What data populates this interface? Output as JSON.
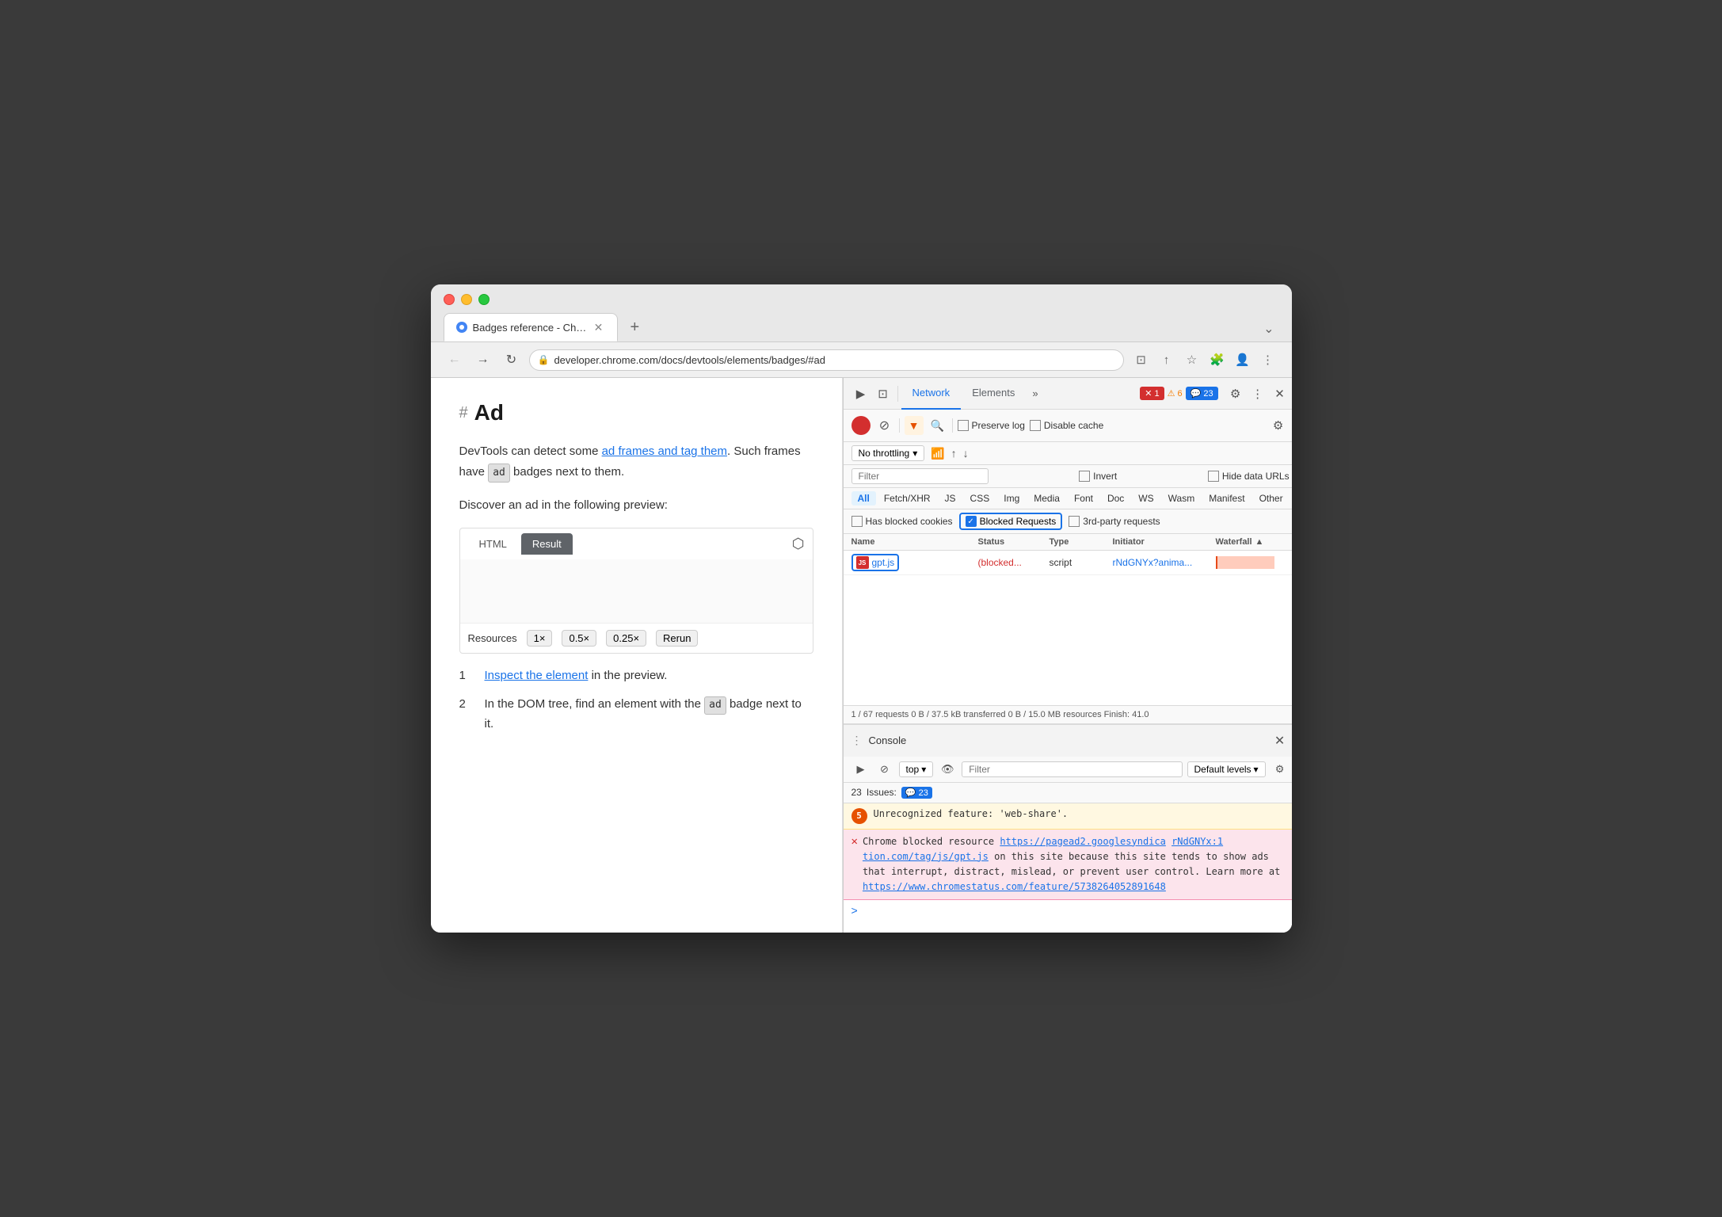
{
  "browser": {
    "tab_title": "Badges reference - Chrome De",
    "tab_favicon": "chrome",
    "address": "developer.chrome.com/docs/devtools/elements/badges/#ad",
    "expand_icon": "⌄"
  },
  "page": {
    "hash_symbol": "#",
    "title": "Ad",
    "paragraph1_before": "DevTools can detect some ",
    "paragraph1_link1": "ad frames and tag them",
    "paragraph1_mid": ". Such frames have ",
    "paragraph1_badge": "ad",
    "paragraph1_after": " badges next to them.",
    "paragraph2": "Discover an ad in the following preview:",
    "preview_tabs": [
      "HTML",
      "Result"
    ],
    "preview_tab_active": "Result",
    "preview_footer_label": "Resources",
    "preview_buttons": [
      "1×",
      "0.5×",
      "0.25×",
      "Rerun"
    ],
    "list_items": [
      {
        "num": "1",
        "text_before": "",
        "link": "Inspect the element",
        "text_after": " in the preview."
      },
      {
        "num": "2",
        "text_before": "In the DOM tree, find an element with the ",
        "badge": "ad",
        "text_after": " badge next to it."
      }
    ]
  },
  "devtools": {
    "tabs": [
      "Network",
      "Elements"
    ],
    "active_tab": "Network",
    "more_icon": "»",
    "badge_error": "1",
    "badge_warn": "6",
    "badge_info": "23",
    "settings_icon": "⚙",
    "more_vert_icon": "⋮",
    "close_icon": "✕",
    "toolbar": {
      "record_title": "record",
      "stop_title": "stop",
      "filter_title": "filter",
      "search_title": "search",
      "preserve_log": "Preserve log",
      "disable_cache": "Disable cache",
      "settings_icon": "⚙"
    },
    "throttle": {
      "label": "No throttling",
      "wifi_icon": "wifi",
      "up_icon": "↑",
      "down_icon": "↓"
    },
    "filter": {
      "placeholder": "Filter",
      "invert_label": "Invert",
      "hide_data_urls_label": "Hide data URLs"
    },
    "type_filters": [
      "All",
      "Fetch/XHR",
      "JS",
      "CSS",
      "Img",
      "Media",
      "Font",
      "Doc",
      "WS",
      "Wasm",
      "Manifest",
      "Other"
    ],
    "active_type": "All",
    "blocked_row": {
      "has_blocked_cookies": "Has blocked cookies",
      "blocked_requests": "Blocked Requests",
      "blocked_checked": true,
      "third_party": "3rd-party requests"
    },
    "table": {
      "headers": [
        "Name",
        "Status",
        "Type",
        "Initiator",
        "Waterfall"
      ],
      "rows": [
        {
          "name": "gpt.js",
          "status": "(blocked...",
          "type": "script",
          "initiator": "rNdGNYx?anima...",
          "has_waterfall": true
        }
      ]
    },
    "status_bar": "1 / 67 requests    0 B / 37.5 kB transferred    0 B / 15.0 MB resources    Finish: 41.0",
    "console": {
      "title": "Console",
      "close_icon": "✕",
      "toolbar": {
        "run_icon": "▶",
        "stop_icon": "⊘",
        "top_label": "top",
        "chevron_icon": "▾",
        "eye_icon": "👁",
        "filter_placeholder": "Filter",
        "levels_label": "Default levels",
        "levels_chevron": "▾",
        "settings_icon": "⚙"
      },
      "issues_bar": {
        "count": "23",
        "label": "Issues:",
        "badge": "23"
      },
      "messages": [
        {
          "type": "warning",
          "badge": "5",
          "text": "Unrecognized feature: 'web-share'."
        },
        {
          "type": "error",
          "text_before": "Chrome blocked resource ",
          "link1": "https://pagead2.googlesyndica",
          "link2": "rNdGNYx:1",
          "text_middle": "tion.com/tag/js/gpt.js",
          "text_bold": " on this site because this site tends to show ads that interrupt, distract, mislead, or prevent user control. Learn more at ",
          "link3": "https://www.chromestatus.com/feature/5738264052891648"
        }
      ],
      "chevron": ">"
    }
  }
}
